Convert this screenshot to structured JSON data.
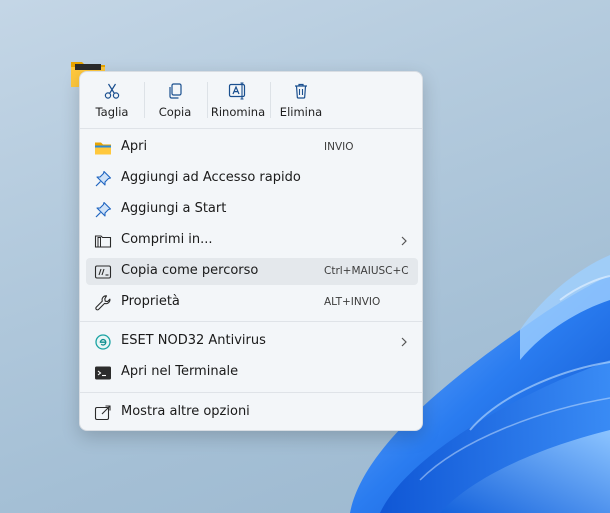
{
  "toolbar": {
    "cut_label": "Taglia",
    "copy_label": "Copia",
    "rename_label": "Rinomina",
    "delete_label": "Elimina"
  },
  "items": [
    {
      "label": "Apri",
      "shortcut": "INVIO",
      "icon": "folder-icon"
    },
    {
      "label": "Aggiungi ad Accesso rapido",
      "shortcut": "",
      "icon": "pin-icon"
    },
    {
      "label": "Aggiungi a Start",
      "shortcut": "",
      "icon": "pin-icon"
    },
    {
      "label": "Comprimi in...",
      "shortcut": "",
      "icon": "archive-icon",
      "submenu": true
    },
    {
      "label": "Copia come percorso",
      "shortcut": "Ctrl+MAIUSC+C",
      "icon": "path-icon"
    },
    {
      "label": "Proprietà",
      "shortcut": "ALT+INVIO",
      "icon": "wrench-icon"
    },
    {
      "label": "ESET NOD32 Antivirus",
      "shortcut": "",
      "icon": "eset-icon",
      "submenu": true
    },
    {
      "label": "Apri nel Terminale",
      "shortcut": "",
      "icon": "terminal-icon"
    },
    {
      "label": "Mostra altre opzioni",
      "shortcut": "",
      "icon": "more-options-icon"
    }
  ],
  "colors": {
    "accent": "#0067c0",
    "menu_bg": "#f3f6f9",
    "hover_bg": "#e4e8ec",
    "wallpaper_blue": "#1a6fe0"
  }
}
